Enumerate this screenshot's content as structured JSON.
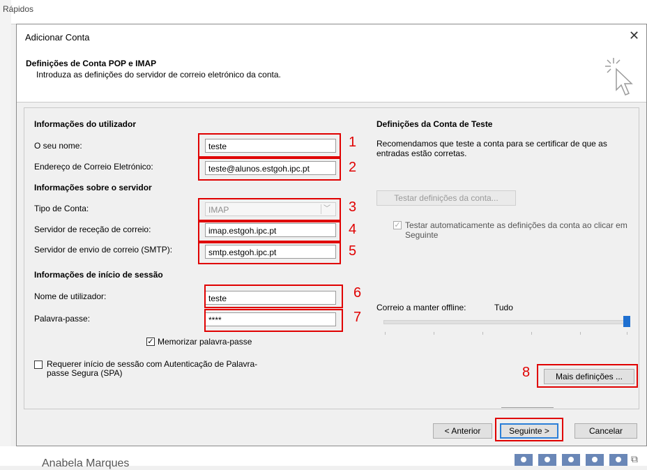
{
  "background": {
    "quick_label": "Rápidos",
    "person_name": "Anabela Marques"
  },
  "dialog": {
    "title": "Adicionar Conta",
    "heading": "Definições de Conta POP e IMAP",
    "subheading": "Introduza as definições do servidor de correio eletrónico da conta.",
    "user_info": {
      "section": "Informações do utilizador",
      "name_label": "O seu nome:",
      "name_value": "teste",
      "email_label": "Endereço de Correio Eletrónico:",
      "email_value": "teste@alunos.estgoh.ipc.pt"
    },
    "server_info": {
      "section": "Informações sobre o servidor",
      "type_label": "Tipo de Conta:",
      "type_value": "IMAP",
      "incoming_label": "Servidor de receção de correio:",
      "incoming_value": "imap.estgoh.ipc.pt",
      "outgoing_label": "Servidor de envio de correio (SMTP):",
      "outgoing_value": "smtp.estgoh.ipc.pt"
    },
    "login_info": {
      "section": "Informações de início de sessão",
      "user_label": "Nome de utilizador:",
      "user_value": "teste",
      "password_label": "Palavra-passe:",
      "password_value": "****",
      "remember_label": "Memorizar palavra-passe",
      "remember_checked": true,
      "spa_label": "Requerer início de sessão com Autenticação de Palavra-passe Segura (SPA)",
      "spa_checked": false
    },
    "test": {
      "section": "Definições da Conta de Teste",
      "description": "Recomendamos que teste a conta para se certificar de que as entradas estão corretas.",
      "test_button": "Testar definições da conta...",
      "auto_test_label": "Testar automaticamente as definições da conta ao clicar em Seguinte",
      "auto_test_checked": true
    },
    "offline": {
      "label": "Correio a manter offline:",
      "value": "Tudo",
      "slider_level": 1.0
    },
    "more_settings_button": "Mais definições ...",
    "back_button": "< Anterior",
    "next_button": "Seguinte >",
    "cancel_button": "Cancelar"
  },
  "annotations": [
    "1",
    "2",
    "3",
    "4",
    "5",
    "6",
    "7",
    "8"
  ],
  "colors": {
    "annotation_red": "#e00000",
    "slider_thumb": "#1e6fd0",
    "default_button_border": "#2b7fd8"
  },
  "icons": {
    "close": "close-icon",
    "cursor": "cursor-sparkle-icon",
    "dropdown": "chevron-down-icon"
  }
}
